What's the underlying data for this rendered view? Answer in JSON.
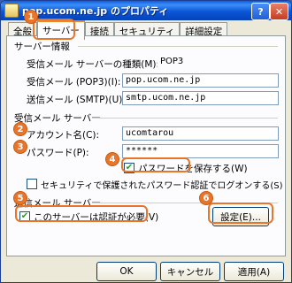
{
  "window": {
    "title": "pop.ucom.ne.jp のプロパティ",
    "help_label": "?",
    "close_label": "✕"
  },
  "tabs": [
    {
      "label": "全般"
    },
    {
      "label": "サーバー"
    },
    {
      "label": "接続"
    },
    {
      "label": "セキュリティ"
    },
    {
      "label": "詳細設定"
    }
  ],
  "server_info": {
    "heading": "サーバー情報",
    "incoming_type_label": "受信メール サーバーの種類(M):",
    "incoming_type_value": "POP3",
    "pop3_label": "受信メール (POP3)(I):",
    "pop3_value": "pop.ucom.ne.jp",
    "smtp_label": "送信メール (SMTP)(U):",
    "smtp_value": "smtp.ucom.ne.jp"
  },
  "incoming_server": {
    "heading": "受信メール サーバー",
    "account_label": "アカウント名(C):",
    "account_value": "ucomtarou",
    "password_label": "パスワード(P):",
    "password_value": "******",
    "remember_password_label": "パスワードを保存する(W)",
    "remember_password_checked": true,
    "spa_label": "セキュリティで保護されたパスワード認証でログオンする(S)",
    "spa_checked": false
  },
  "outgoing_server": {
    "heading": "送信メール サーバー",
    "auth_required_label": "このサーバーは認証が必要(V)",
    "auth_required_checked": true,
    "settings_button": "設定(E)..."
  },
  "footer": {
    "ok": "OK",
    "cancel": "キャンセル",
    "apply": "適用(A)"
  },
  "annotations": [
    "1",
    "2",
    "3",
    "4",
    "5",
    "6"
  ],
  "colors": {
    "accent": "#e8752a",
    "titlebar": "#0a56d9"
  }
}
